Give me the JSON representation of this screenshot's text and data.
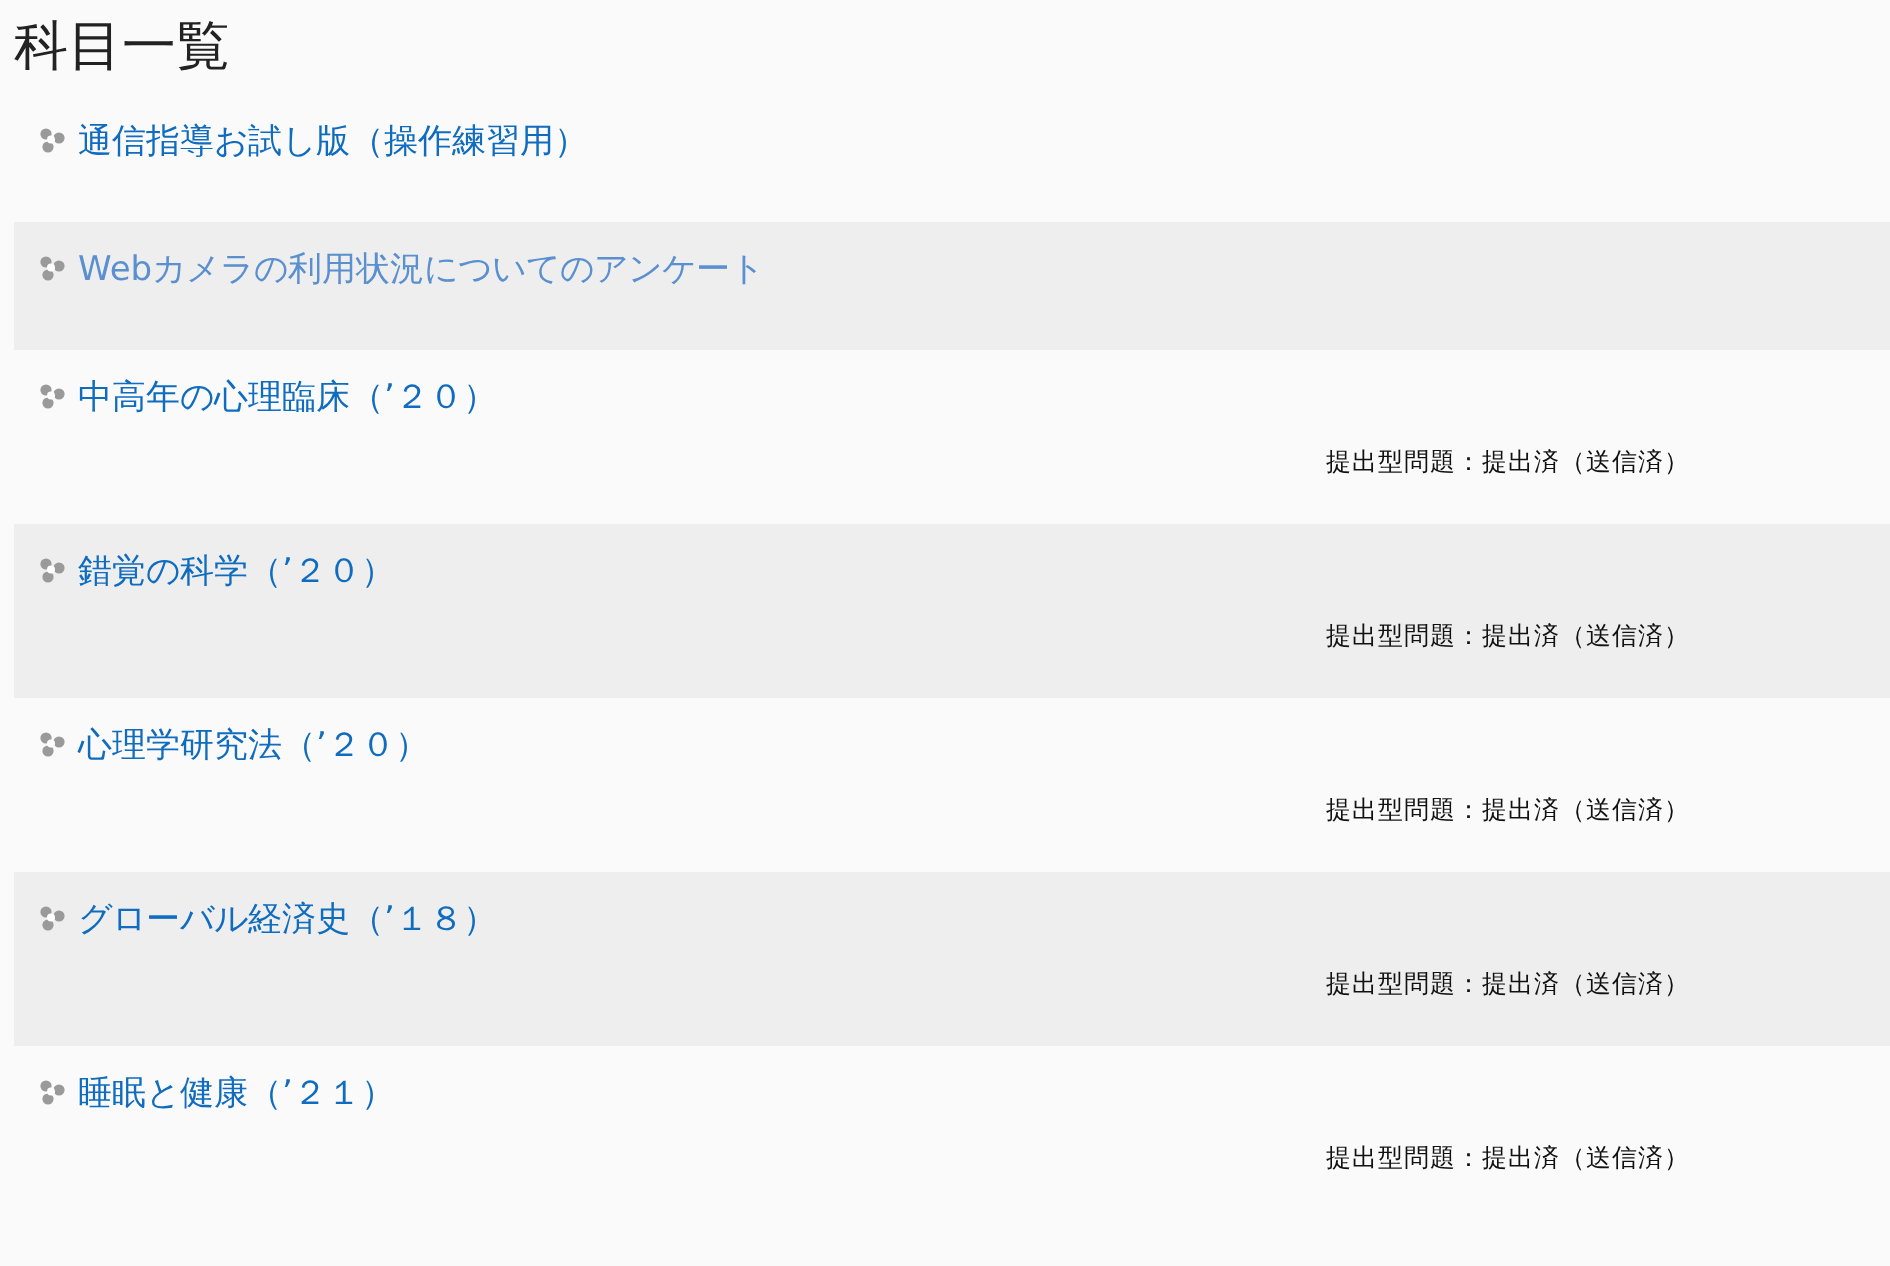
{
  "heading": "科目一覧",
  "courses": [
    {
      "title": "通信指導お試し版（操作練習用）",
      "dimmed": false
    },
    {
      "title": "Webカメラの利用状況についてのアンケート",
      "dimmed": true
    },
    {
      "title": "中高年の心理臨床（’２０）",
      "dimmed": false,
      "status": "提出型問題：提出済（送信済）"
    },
    {
      "title": "錯覚の科学（’２０）",
      "dimmed": false,
      "status": "提出型問題：提出済（送信済）"
    },
    {
      "title": "心理学研究法（’２０）",
      "dimmed": false,
      "status": "提出型問題：提出済（送信済）"
    },
    {
      "title": "グローバル経済史（’１８）",
      "dimmed": false,
      "status": "提出型問題：提出済（送信済）"
    },
    {
      "title": "睡眠と健康（’２１）",
      "dimmed": false,
      "status": "提出型問題：提出済（送信済）"
    }
  ]
}
